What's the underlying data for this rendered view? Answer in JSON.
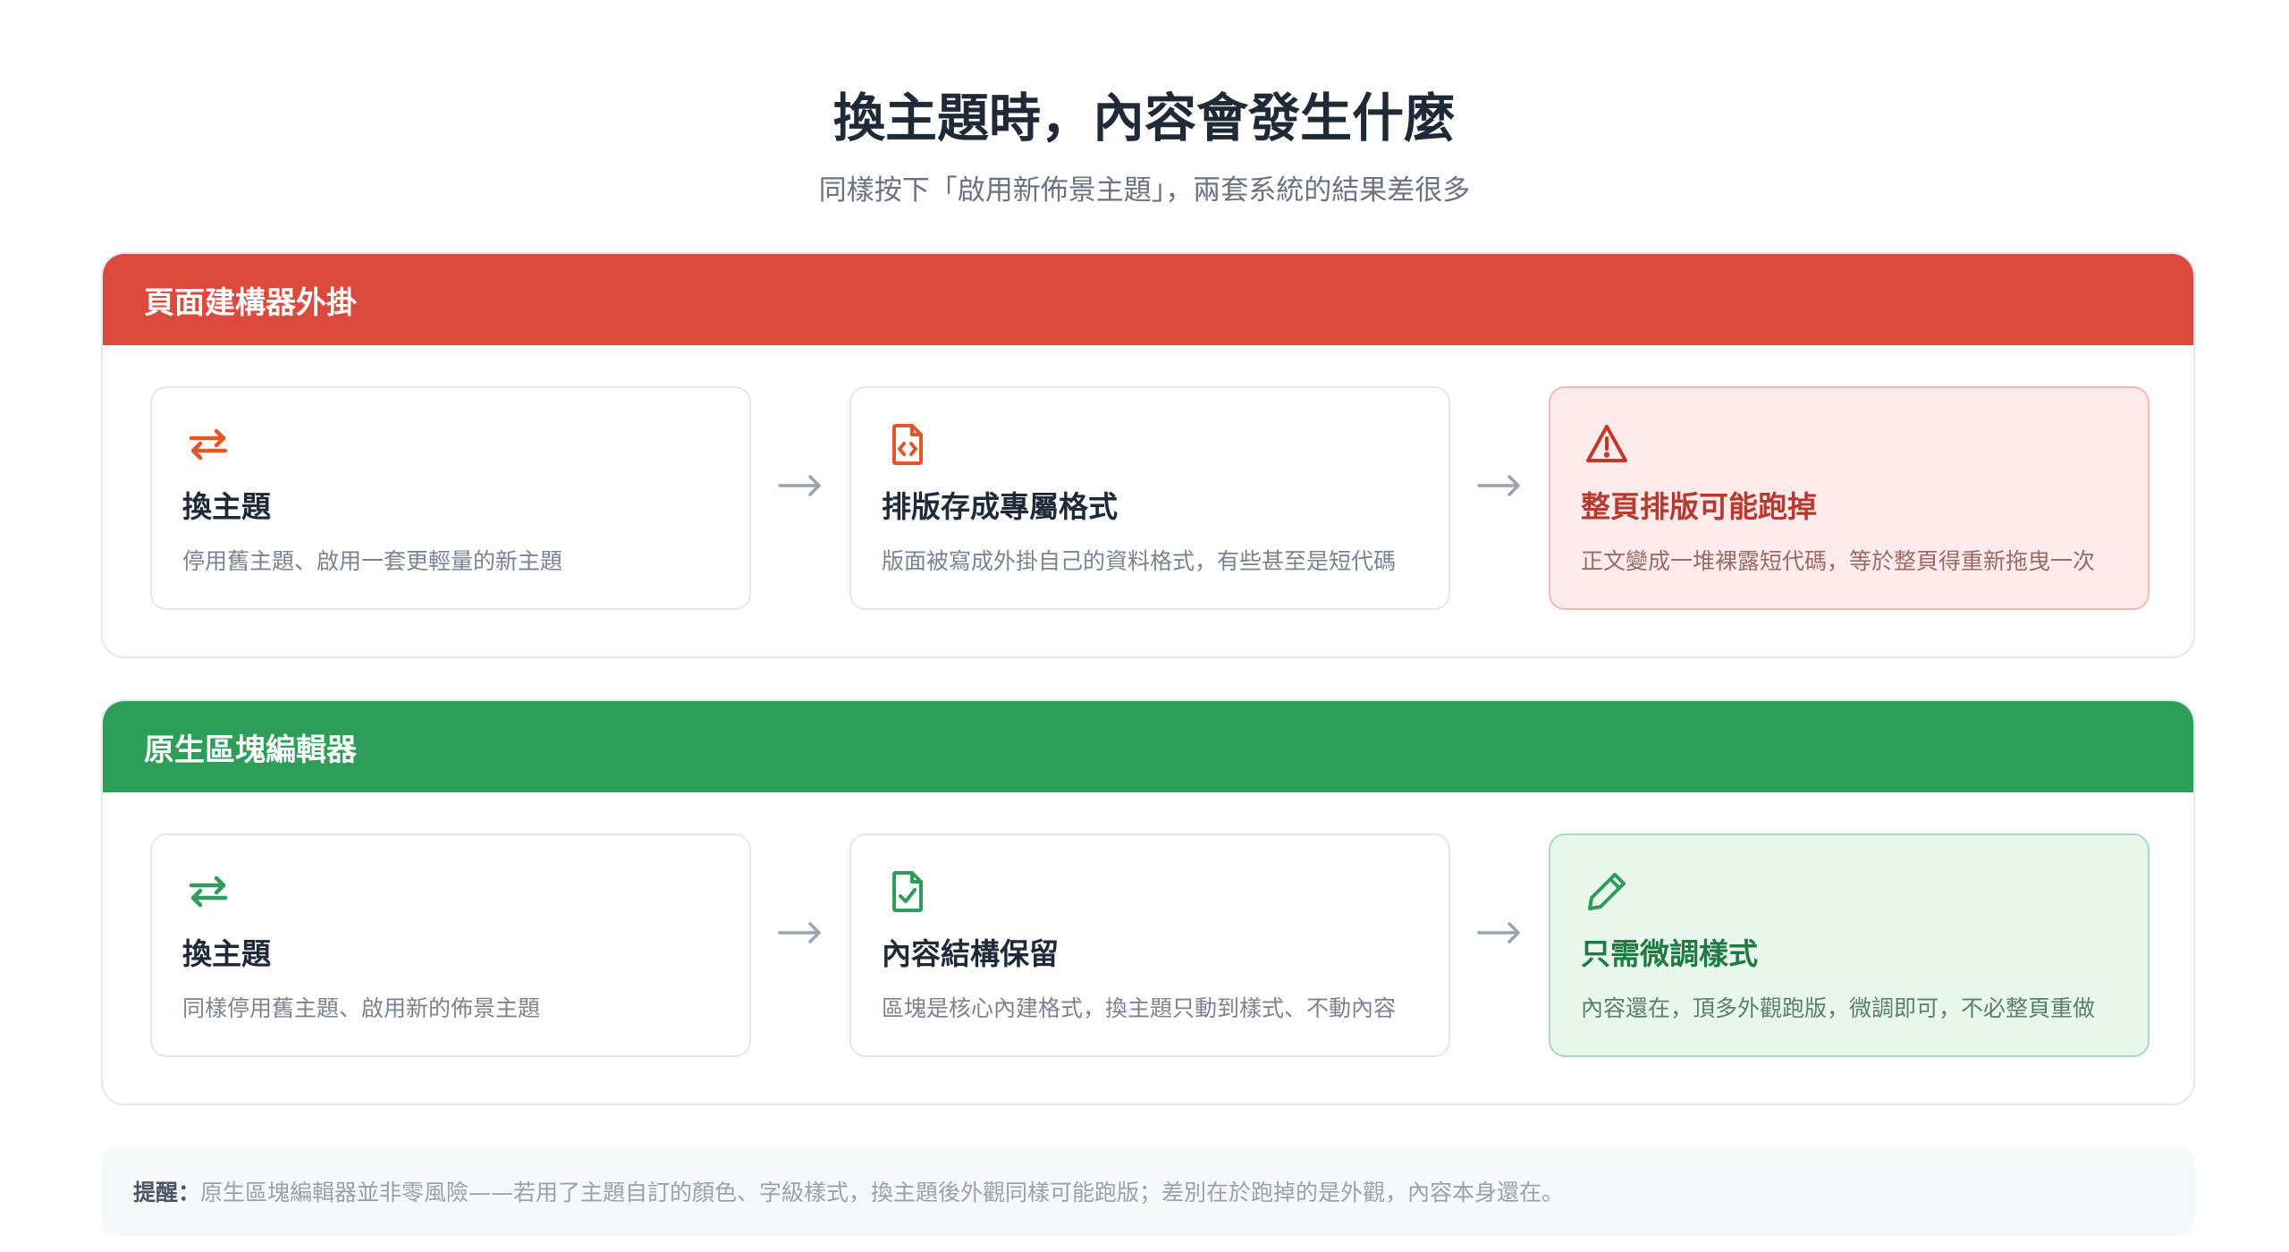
{
  "title": "換主題時，內容會發生什麼",
  "subtitle": "同樣按下「啟用新佈景主題」，兩套系統的結果差很多",
  "panels": [
    {
      "heading": "頁面建構器外掛",
      "color": "#db4a3d",
      "cards": [
        {
          "icon": "swap-arrows-icon",
          "title": "換主題",
          "desc": "停用舊主題、啟用一套更輕量的新主題"
        },
        {
          "icon": "code-file-icon",
          "title": "排版存成專屬格式",
          "desc": "版面被寫成外掛自己的資料格式，有些甚至是短代碼"
        },
        {
          "icon": "warning-triangle-icon",
          "title": "整頁排版可能跑掉",
          "desc": "正文變成一堆裸露短代碼，等於整頁得重新拖曳一次"
        }
      ]
    },
    {
      "heading": "原生區塊編輯器",
      "color": "#2c9e5a",
      "cards": [
        {
          "icon": "swap-arrows-icon",
          "title": "換主題",
          "desc": "同樣停用舊主題、啟用新的佈景主題"
        },
        {
          "icon": "checked-file-icon",
          "title": "內容結構保留",
          "desc": "區塊是核心內建格式，換主題只動到樣式、不動內容"
        },
        {
          "icon": "pencil-icon",
          "title": "只需微調樣式",
          "desc": "內容還在，頂多外觀跑版，微調即可，不必整頁重做"
        }
      ]
    }
  ],
  "note": {
    "label": "提醒：",
    "text": "原生區塊編輯器並非零風險——若用了主題自訂的顏色、字級樣式，換主題後外觀同樣可能跑版；差別在於跑掉的是外觀，內容本身還在。"
  }
}
